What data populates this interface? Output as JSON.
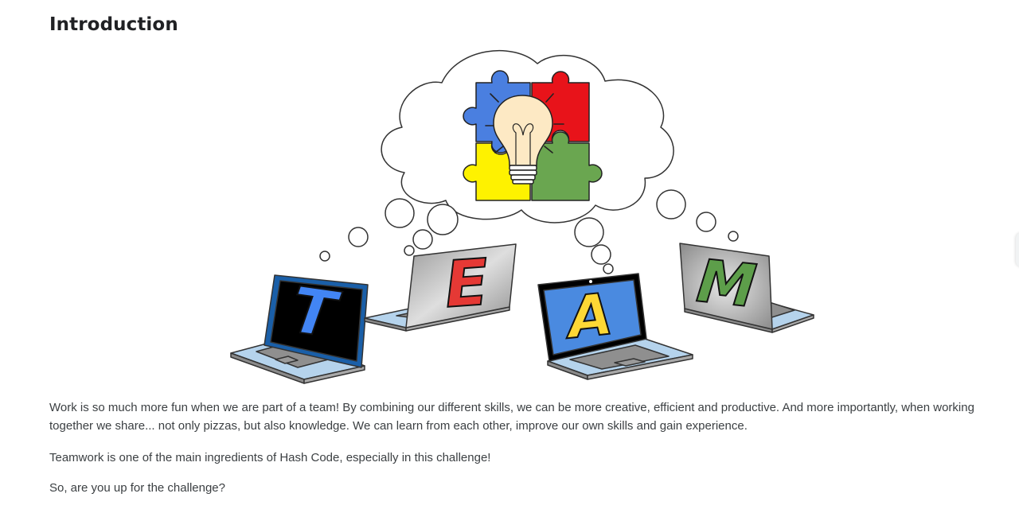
{
  "page": {
    "title": "Introduction"
  },
  "illustration": {
    "letters": [
      "T",
      "E",
      "A",
      "M"
    ],
    "letter_colors": [
      "#4285f4",
      "#e53935",
      "#fdd835",
      "#5d9e4a"
    ],
    "puzzle_colors": [
      "#4a7fe0",
      "#e8131a",
      "#fef200",
      "#6aa650"
    ],
    "icons": [
      "thought-cloud-icon",
      "puzzle-pieces-icon",
      "light-bulb-icon",
      "laptop-icon"
    ]
  },
  "content": {
    "paragraphs": [
      "Work is so much more fun when we are part of a team! By combining our different skills, we can be more creative, efficient and productive. And more importantly, when working together we share... not only pizzas, but also knowledge. We can learn from each other, improve our own skills and gain experience.",
      "Teamwork is one of the main ingredients of Hash Code, especially in this challenge!",
      "So, are you up for the challenge?"
    ]
  }
}
